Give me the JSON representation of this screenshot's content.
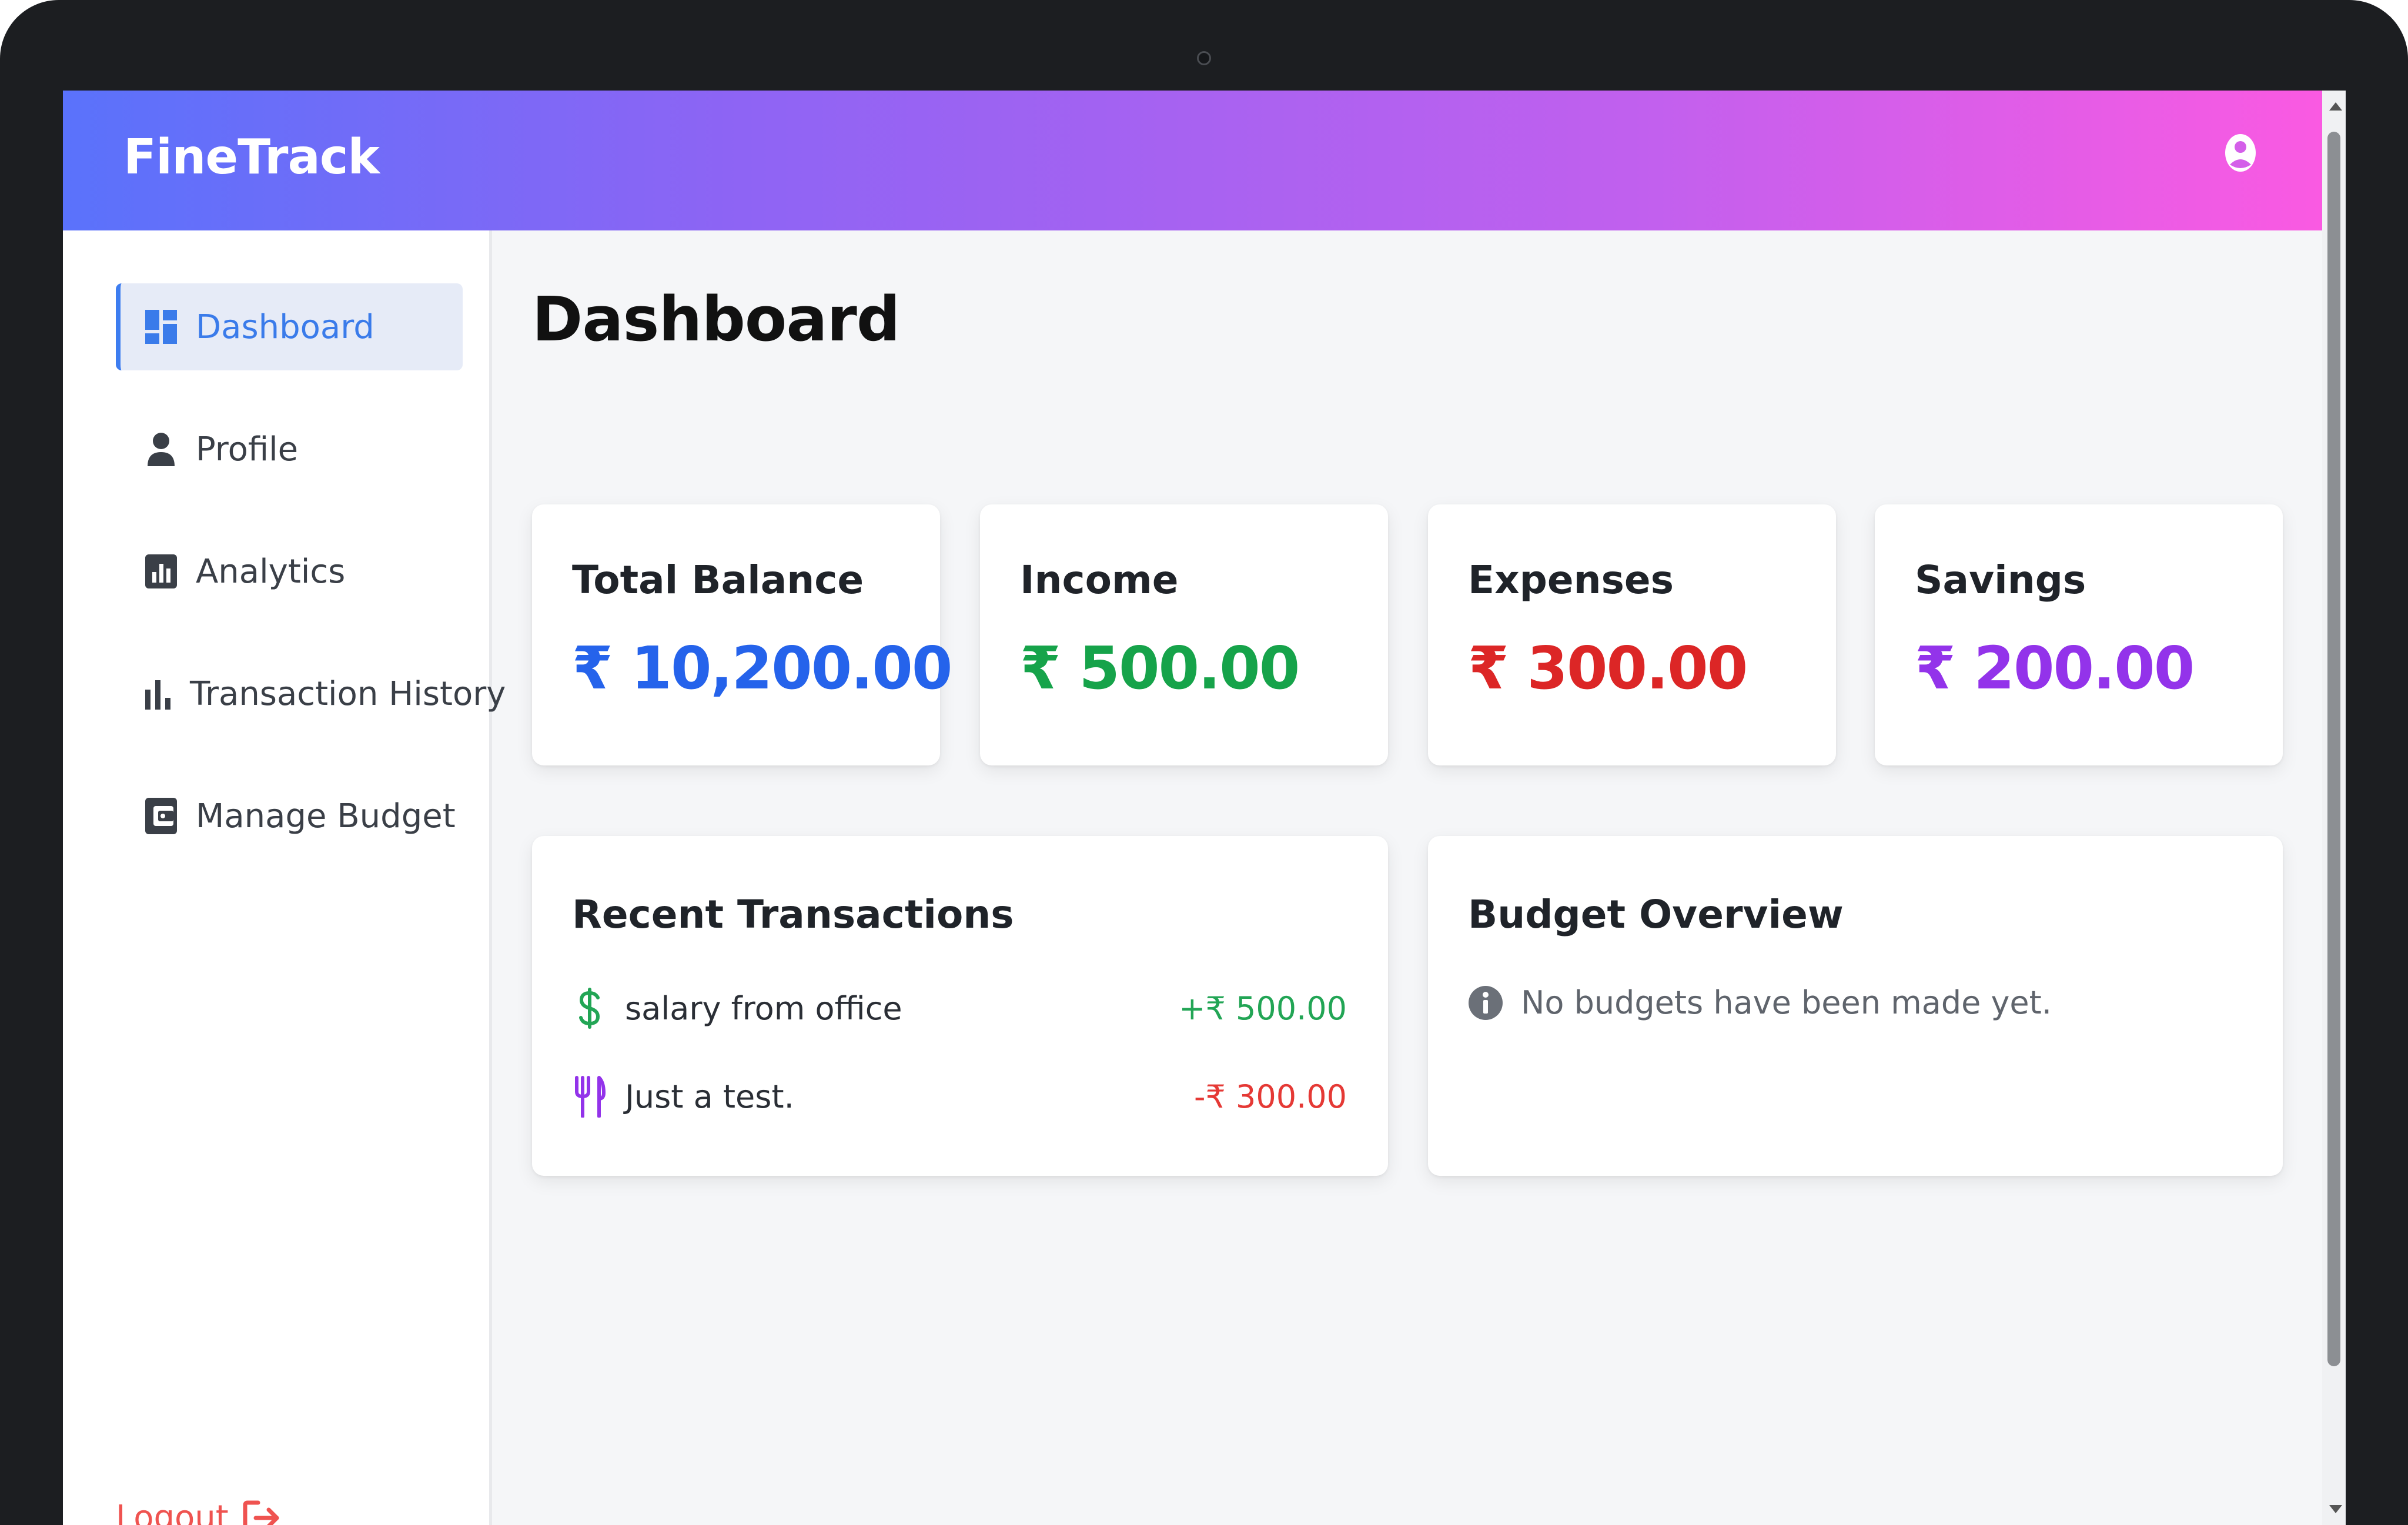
{
  "app": {
    "brand": "FineTrack"
  },
  "sidebar": {
    "items": [
      {
        "label": "Dashboard",
        "icon": "dashboard-icon",
        "active": true
      },
      {
        "label": "Profile",
        "icon": "person-icon",
        "active": false
      },
      {
        "label": "Analytics",
        "icon": "analytics-icon",
        "active": false
      },
      {
        "label": "Transaction History",
        "icon": "bar-chart-icon",
        "active": false
      },
      {
        "label": "Manage Budget",
        "icon": "wallet-icon",
        "active": false
      }
    ],
    "logout_label": "Logout"
  },
  "main": {
    "title": "Dashboard",
    "stats": [
      {
        "title": "Total Balance",
        "value": "₹ 10,200.00",
        "color": "#2563eb"
      },
      {
        "title": "Income",
        "value": "₹ 500.00",
        "color": "#16a34a"
      },
      {
        "title": "Expenses",
        "value": "₹ 300.00",
        "color": "#dc2626"
      },
      {
        "title": "Savings",
        "value": "₹ 200.00",
        "color": "#9333ea"
      }
    ],
    "recent": {
      "title": "Recent Transactions",
      "rows": [
        {
          "desc": "salary from office",
          "amount": "+₹ 500.00",
          "icon": "dollar-icon",
          "color": "#22a555"
        },
        {
          "desc": "Just a test.",
          "amount": "-₹ 300.00",
          "icon": "fork-knife-icon",
          "color": "#e53935"
        }
      ]
    },
    "budget": {
      "title": "Budget Overview",
      "empty_text": "No budgets have been made yet."
    }
  },
  "colors": {
    "accent": "#3a7bea",
    "logout": "#ef5350",
    "header_gradient": [
      "#5a72fb",
      "#fa5ae2"
    ]
  }
}
